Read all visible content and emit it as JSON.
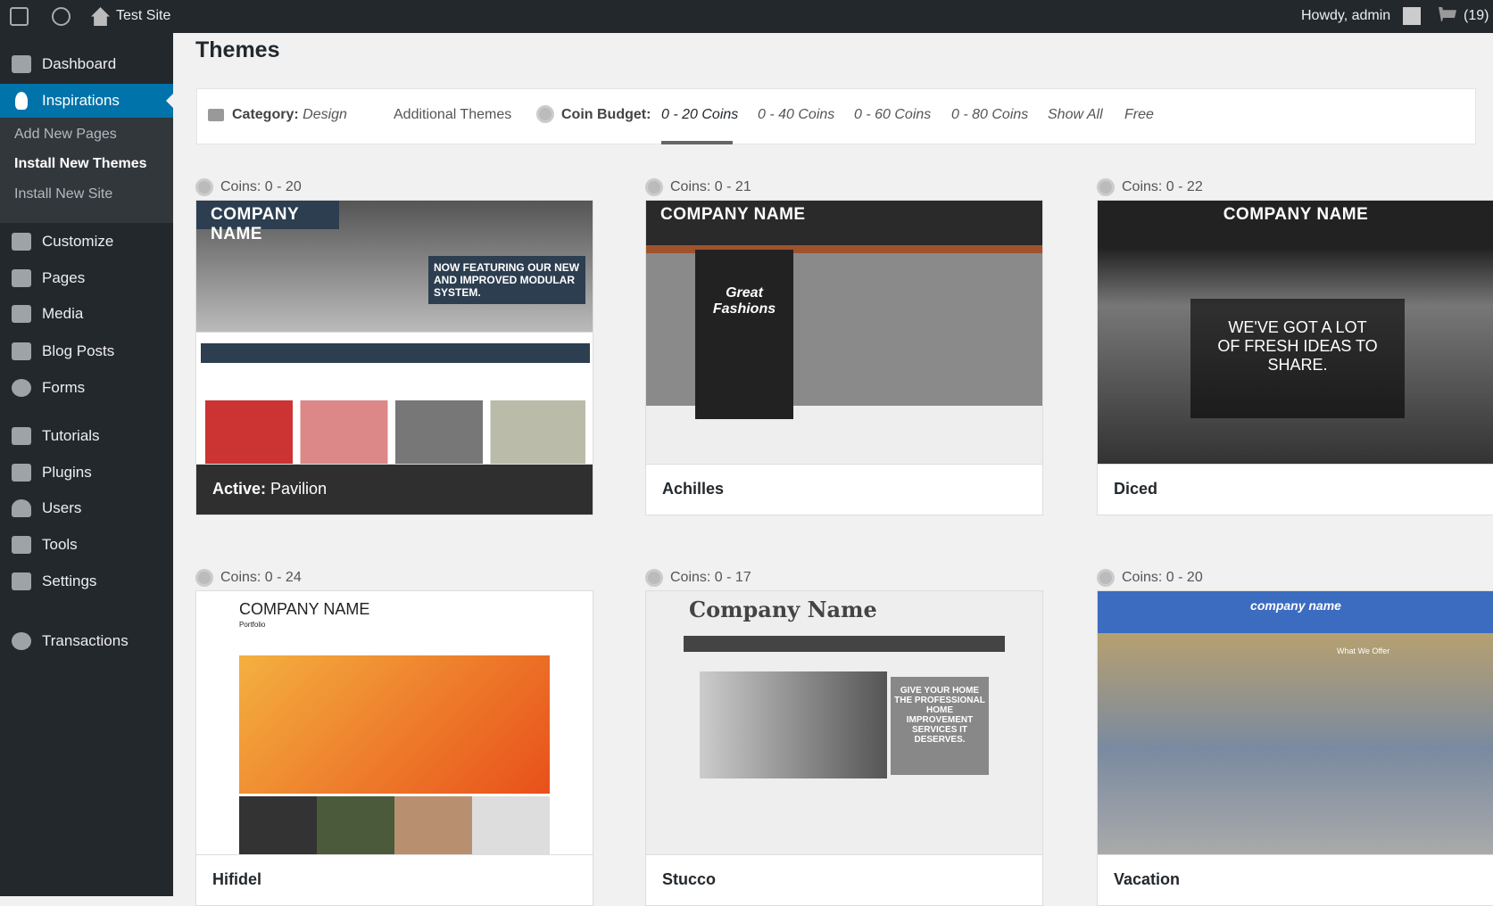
{
  "topbar": {
    "site": "Test Site",
    "howdy": "Howdy, admin",
    "cart_count": "(19)"
  },
  "sidebar": {
    "items": [
      {
        "label": "Dashboard"
      },
      {
        "label": "Inspirations"
      },
      {
        "label": "Customize"
      },
      {
        "label": "Pages"
      },
      {
        "label": "Media"
      },
      {
        "label": "Blog Posts"
      },
      {
        "label": "Forms"
      },
      {
        "label": "Tutorials"
      },
      {
        "label": "Plugins"
      },
      {
        "label": "Users"
      },
      {
        "label": "Tools"
      },
      {
        "label": "Settings"
      },
      {
        "label": "Transactions"
      }
    ],
    "submenu": [
      {
        "label": "Add New Pages"
      },
      {
        "label": "Install New Themes"
      },
      {
        "label": "Install New Site"
      }
    ]
  },
  "page_title": "Themes",
  "filter": {
    "category_label": "Category:",
    "category_value": "Design",
    "additional": "Additional Themes",
    "budget_label": "Coin Budget:",
    "options": [
      "0 - 20 Coins",
      "0 - 40 Coins",
      "0 - 60 Coins",
      "0 - 80 Coins",
      "Show All",
      "Free"
    ],
    "selected": "0 - 20 Coins"
  },
  "themes": [
    {
      "coins": "Coins: 0 - 20",
      "name": "Pavilion",
      "active_prefix": "Active:",
      "thumb_title": "COMPANY NAME",
      "thumb_text": "NOW FEATURING OUR NEW AND IMPROVED MODULAR SYSTEM."
    },
    {
      "coins": "Coins: 0 - 21",
      "name": "Achilles",
      "thumb_title": "COMPANY NAME",
      "thumb_text": "Great Fashions"
    },
    {
      "coins": "Coins: 0 - 22",
      "name": "Diced",
      "thumb_title": "COMPANY NAME",
      "thumb_text": "WE'VE GOT A LOT OF FRESH IDEAS TO SHARE."
    },
    {
      "coins": "Coins: 0 - 24",
      "name": "Hifidel",
      "thumb_title": "COMPANY NAME",
      "thumb_text": "Portfolio"
    },
    {
      "coins": "Coins: 0 - 17",
      "name": "Stucco",
      "thumb_title": "Company Name",
      "thumb_text": "GIVE YOUR HOME THE PROFESSIONAL HOME IMPROVEMENT SERVICES IT DESERVES."
    },
    {
      "coins": "Coins: 0 - 20",
      "name": "Vacation",
      "thumb_title": "company name",
      "thumb_text": "What We Offer"
    }
  ]
}
